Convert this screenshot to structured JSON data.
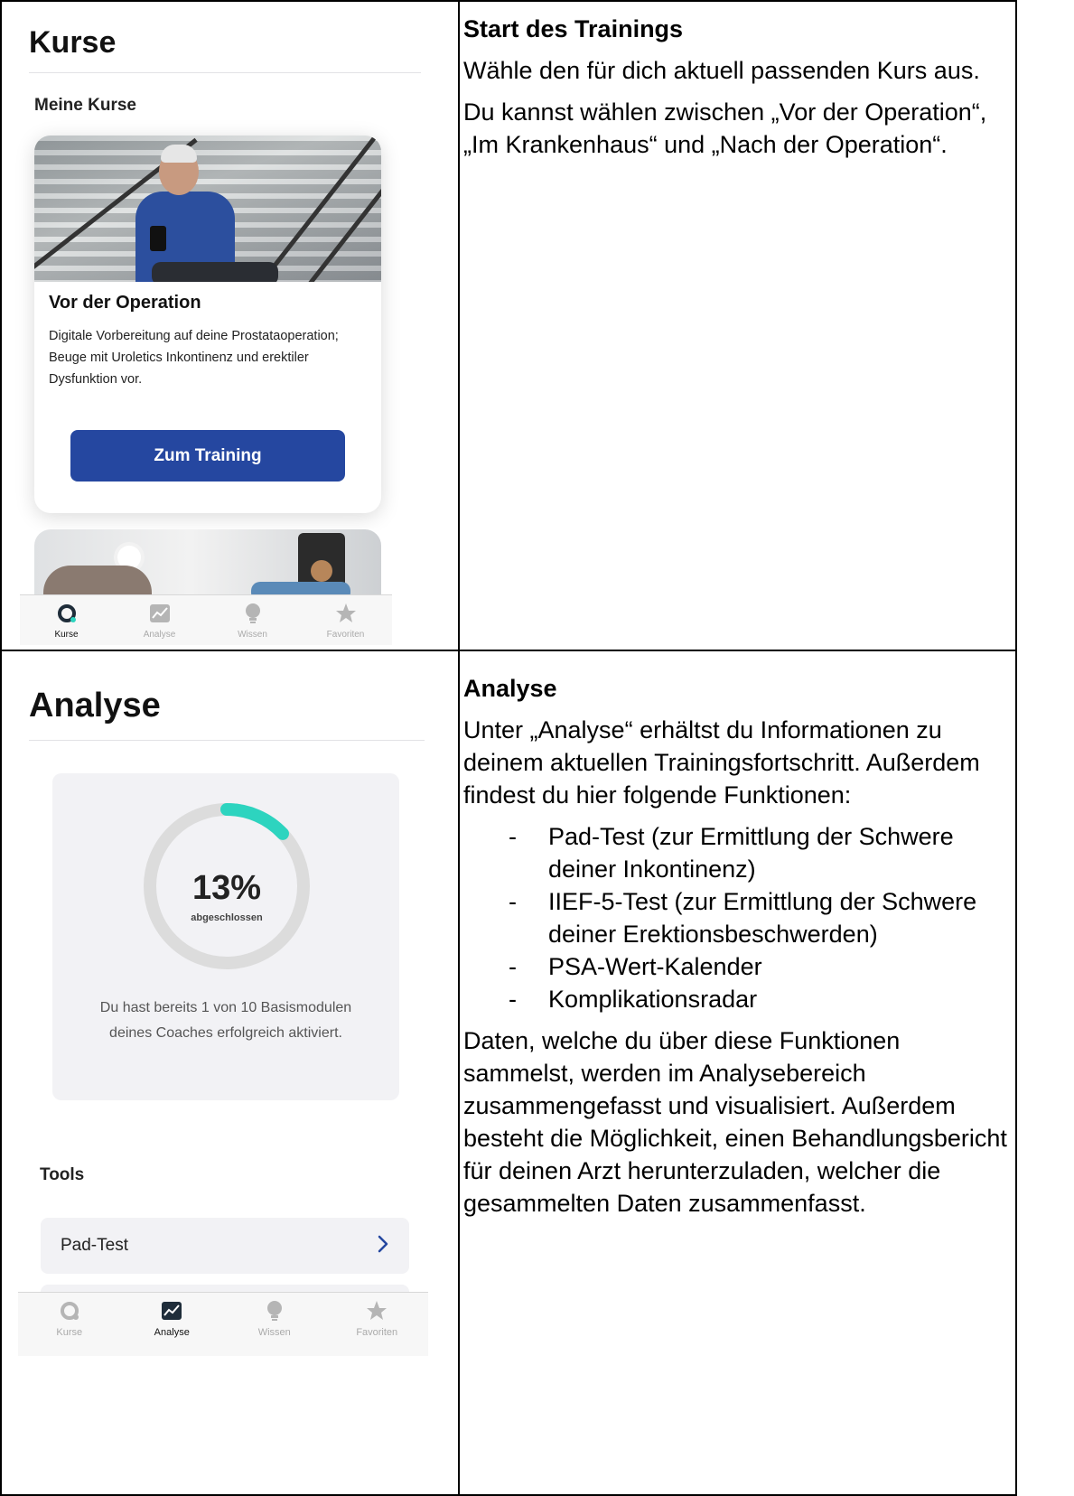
{
  "row1": {
    "app": {
      "title": "Kurse",
      "section": "Meine Kurse",
      "course": {
        "title": "Vor der Operation",
        "description": "Digitale Vorbereitung auf deine Prostataoperation; Beuge mit Uroletics Inkontinenz und erektiler Dysfunktion vor.",
        "button": "Zum Training"
      },
      "tabs": [
        "Kurse",
        "Analyse",
        "Wissen",
        "Favoriten"
      ],
      "active_tab": "Kurse"
    },
    "text": {
      "heading": "Start des Trainings",
      "p1": "Wähle den für dich aktuell passenden Kurs aus.",
      "p2": "Du kannst wählen zwischen „Vor der Operation“, „Im Krankenhaus“ und „Nach der Operation“."
    }
  },
  "row2": {
    "app": {
      "title": "Analyse",
      "progress": {
        "percent_text": "13%",
        "percent_value": 0.13,
        "label": "abgeschlossen",
        "text": "Du hast bereits 1 von 10 Basismodulen deines Coaches erfolgreich aktiviert."
      },
      "section": "Tools",
      "tool": "Pad-Test",
      "tabs": [
        "Kurse",
        "Analyse",
        "Wissen",
        "Favoriten"
      ],
      "active_tab": "Analyse"
    },
    "text": {
      "heading": "Analyse",
      "p1": "Unter „Analyse“ erhältst du Informationen zu deinem aktuellen Trainingsfortschritt. Außerdem findest du hier folgende Funktionen:",
      "bullets": [
        "Pad-Test (zur Ermittlung der Schwere deiner Inkontinenz)",
        "IIEF-5-Test (zur Ermittlung der Schwere deiner Erektionsbeschwerden)",
        "PSA-Wert-Kalender",
        "Komplikationsradar"
      ],
      "p2": "Daten, welche du über diese Funktionen sammelst, werden im Analysebereich zusammengefasst und visualisiert. Außerdem besteht die Möglichkeit, einen Behandlungsbericht für deinen Arzt herunterzuladen, welcher die gesammelten Daten zusammenfasst."
    }
  },
  "colors": {
    "button_blue": "#2547a0",
    "progress_teal": "#2dd4bf",
    "ring_gray": "#dcdcdc",
    "tab_active": "#111111",
    "tab_inactive": "#aaaaaa",
    "chevron_blue": "#2547a0"
  },
  "icons": {
    "kurse": "ring-logo-icon",
    "analyse": "chart-icon",
    "wissen": "lightbulb-icon",
    "favoriten": "star-icon",
    "chevron": "chevron-right-icon"
  }
}
